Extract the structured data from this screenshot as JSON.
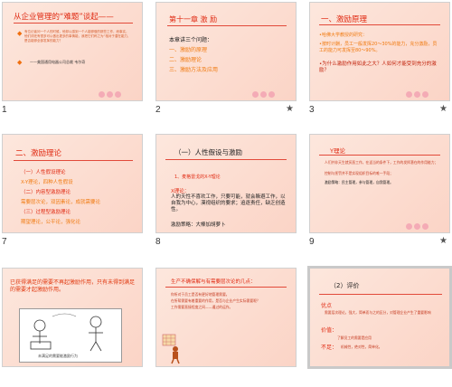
{
  "slides": [
    {
      "num": "1",
      "title": "从企业管理的“难题”谈起——",
      "lines": [
        "有位记者问一个人的时候，他却以感到一个人能够做的那些工作，而事实，他们却还有很多可以做出更多的事情能，我把它们称之为“相对于潜在能力，是否能够全部发挥的能力？"
      ],
      "footer": "——美国通用电器公司总裁  韦尔奇",
      "star": ""
    },
    {
      "num": "2",
      "title": "第十一章     激  励",
      "lines": [
        "本章讲三个问题：",
        "一、激励的原理",
        "二、激励理论",
        "三、激励方法及应用"
      ],
      "star": "★"
    },
    {
      "num": "3",
      "title": "一、激励原理",
      "lines": [
        "•哈佛大学教授的研究：",
        "•按时计酬，员工一般发挥20～30%的能力，充分激励，员工的能力可发挥至80～90%。",
        "•为什么激励作用如此之大？人如何才能受到充分的激励？"
      ],
      "star": "★"
    },
    {
      "num": "7",
      "title": "二、激励理论",
      "lines": [
        "（一）人性假设理论",
        "X-Y理论，四种人性假设",
        "（二）内容型激励理论",
        "需要层次论，双因素论，成就需要论",
        "（三）过程型激励理论",
        "期望理论，公平论，强化论"
      ],
      "star": ""
    },
    {
      "num": "8",
      "title": "（一）人性假设与激励",
      "lines": [
        "1、麦格雷戈的X-Y理论",
        "X理论：",
        "人的天性不喜欢工作，只要可能，就会躲避工作，以自我为中心，漠视组织的要求；追逐责任，缺乏创造性。",
        "激励策略：大棒加胡萝卜"
      ],
      "star": ""
    },
    {
      "num": "9",
      "title": "Y理论",
      "lines": [
        "人们并非天生就厌恶工作，在适当的条件下，工作的发挥潜在的作用能力；",
        "控制与惩罚并不是实现组织目标的唯一手段；",
        "激励策略：民主管理，参与管理，自我管理。"
      ],
      "star": "★"
    },
    {
      "num": "",
      "title": "",
      "lines": [
        "已获得满足的需要不再起激励作用，只有未得到满足的需要才起激励作用。"
      ],
      "caption": "未满足的需要能激励行为",
      "star": ""
    },
    {
      "num": "",
      "title": "",
      "lines": [
        "生产不确保解与有需要层次论的几点：",
        "你所对于员工是否有更好地管理需要。",
        "在所帮需要有着重要的作用，是否与企业产生实际需要呢？",
        "工作需要直接程度之间——通过的运作。"
      ],
      "star": ""
    },
    {
      "num": "",
      "title": "（2）评价",
      "lines": [
        "优点",
        "需要层次理论，强大，简单而与之的区分，对管理企业产生了重要影响",
        "价值：",
        "了解员工的需要是应用",
        "不足：",
        "机械性，绝对性，简单化。"
      ],
      "star": ""
    }
  ]
}
